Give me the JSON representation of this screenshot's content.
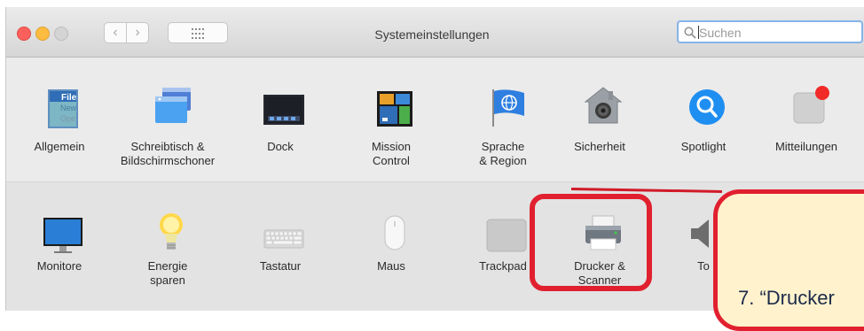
{
  "window": {
    "title": "Systemeinstellungen",
    "search": {
      "placeholder": "Suchen"
    }
  },
  "toolbar": {
    "back_glyph": "‹",
    "forward_glyph": "›"
  },
  "row1": [
    {
      "label": "Allgemein",
      "icon": "general-icon"
    },
    {
      "label": "Schreibtisch &\nBildschirmschoner",
      "icon": "desktop-screensaver-icon"
    },
    {
      "label": "Dock",
      "icon": "dock-icon"
    },
    {
      "label": "Mission\nControl",
      "icon": "mission-control-icon"
    },
    {
      "label": "Sprache\n& Region",
      "icon": "language-region-icon"
    },
    {
      "label": "Sicherheit",
      "icon": "security-icon"
    },
    {
      "label": "Spotlight",
      "icon": "spotlight-icon"
    },
    {
      "label": "Mitteilungen",
      "icon": "notifications-icon"
    }
  ],
  "row2": [
    {
      "label": "Monitore",
      "icon": "displays-icon"
    },
    {
      "label": "Energie\nsparen",
      "icon": "energy-saver-icon"
    },
    {
      "label": "Tastatur",
      "icon": "keyboard-icon"
    },
    {
      "label": "Maus",
      "icon": "mouse-icon"
    },
    {
      "label": "Trackpad",
      "icon": "trackpad-icon"
    },
    {
      "label": "Drucker &\nScanner",
      "icon": "printer-scanner-icon"
    },
    {
      "label": "To",
      "icon": "sound-icon"
    }
  ],
  "general_icon_text": [
    "File",
    "New",
    "Ope"
  ],
  "callout": {
    "text": "7. “Drucker"
  },
  "colors": {
    "highlight": "#e1202f",
    "callout_fill": "#fff2cc",
    "search_focus": "#86b3ea"
  }
}
